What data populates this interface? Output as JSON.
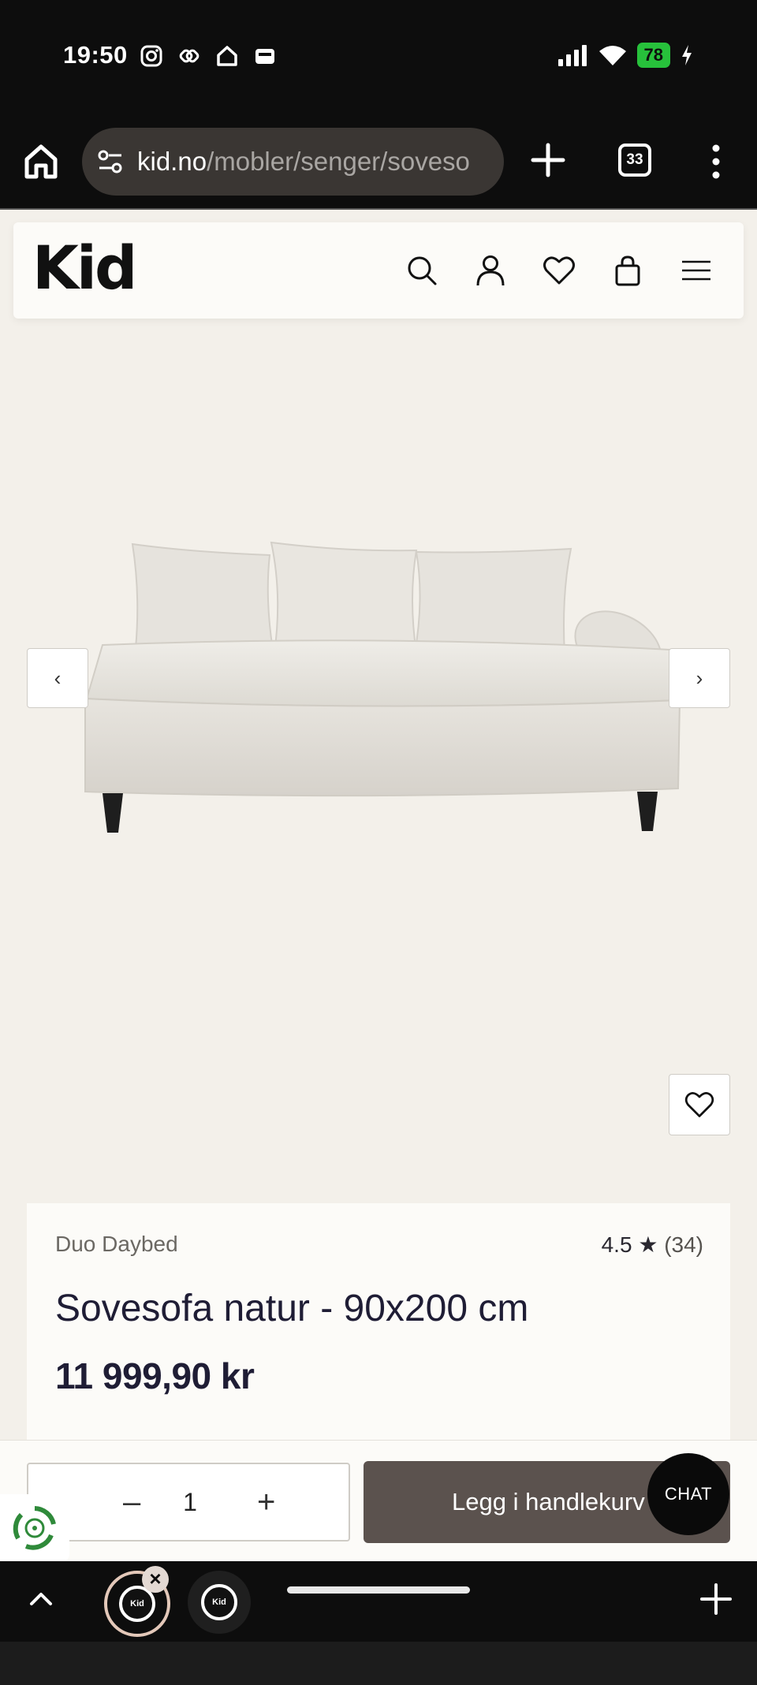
{
  "status_bar": {
    "time": "19:50",
    "battery": "78",
    "icons": [
      "instagram-icon",
      "link-app-icon",
      "home-app-icon",
      "wallet-icon",
      "signal-icon",
      "wifi-icon",
      "battery-icon",
      "charging-icon"
    ]
  },
  "browser": {
    "url_domain": "kid.no",
    "url_path": "/mobler/senger/soveso",
    "tab_count": "33"
  },
  "header": {
    "logo": "Kid",
    "icons": [
      "search-icon",
      "account-icon",
      "wishlist-icon",
      "cart-icon",
      "menu-icon"
    ]
  },
  "gallery": {
    "prev_label": "‹",
    "next_label": "›"
  },
  "product": {
    "brand": "Duo Daybed",
    "rating": "4.5",
    "rating_star": "★",
    "rating_count": "(34)",
    "title": "Sovesofa natur - 90x200 cm",
    "price": "11 999,90 kr"
  },
  "purchase": {
    "qty_minus": "–",
    "quantity": "1",
    "qty_plus": "+",
    "add_to_cart": "Legg i handlekurv",
    "chat": "CHAT"
  },
  "tab_bar": {
    "tab_logo": "Kid"
  },
  "colors": {
    "page_bg": "#f3f0ea",
    "card_bg": "#fcfbf8",
    "cta": "#5b524e",
    "browser_chrome": "#0d0d0d",
    "battery_green": "#27c13b"
  }
}
